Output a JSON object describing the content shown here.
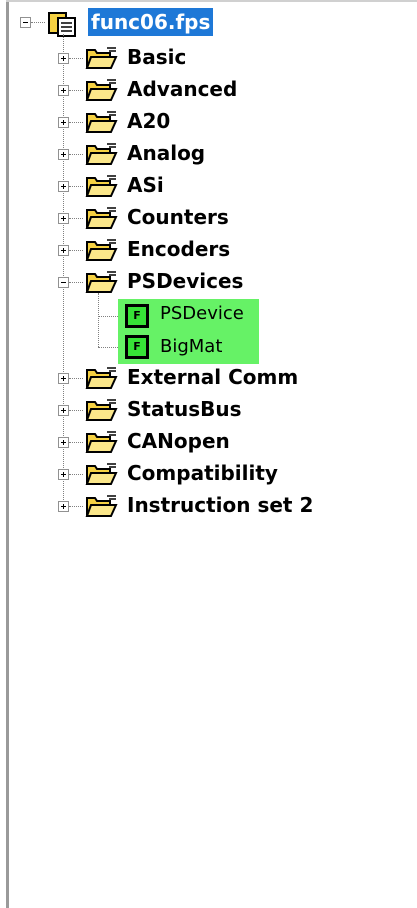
{
  "tree": {
    "root": {
      "label": "func06.fps",
      "icon": "project-files-icon",
      "expanded": true
    },
    "folders": [
      {
        "label": "Basic",
        "expanded": false
      },
      {
        "label": "Advanced",
        "expanded": false
      },
      {
        "label": "A20",
        "expanded": false
      },
      {
        "label": "Analog",
        "expanded": false
      },
      {
        "label": "ASi",
        "expanded": false
      },
      {
        "label": "Counters",
        "expanded": false
      },
      {
        "label": "Encoders",
        "expanded": false
      },
      {
        "label": "PSDevices",
        "expanded": true,
        "children": [
          {
            "label": "PSDevice",
            "icon": "function-block-icon",
            "icon_text": "F"
          },
          {
            "label": "BigMat",
            "icon": "function-block-icon",
            "icon_text": "F"
          }
        ]
      },
      {
        "label": "External Comm",
        "expanded": false
      },
      {
        "label": "StatusBus",
        "expanded": false
      },
      {
        "label": "CANopen",
        "expanded": false
      },
      {
        "label": "Compatibility",
        "expanded": false
      },
      {
        "label": "Instruction set 2",
        "expanded": false
      }
    ]
  },
  "colors": {
    "selection": "#1e78d7",
    "leaf_highlight": "#66f266",
    "folder": "#f5d142",
    "function_block": "#37e237"
  }
}
